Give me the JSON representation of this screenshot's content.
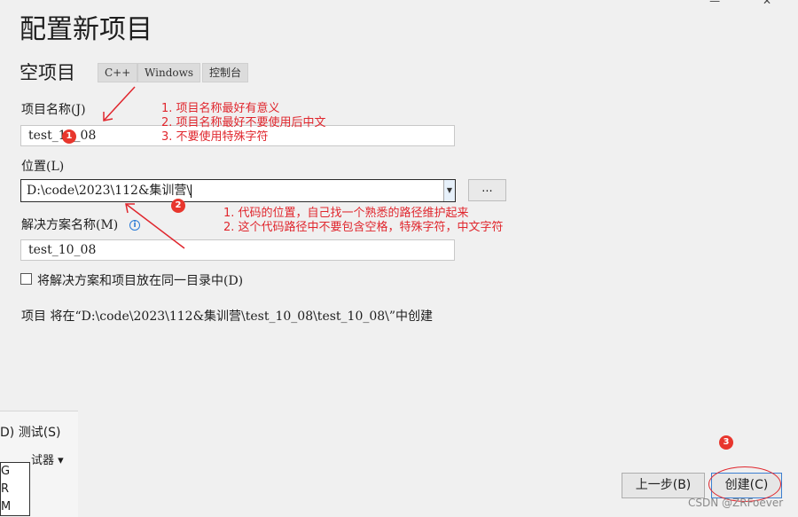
{
  "window": {
    "controls": "— ✕"
  },
  "dialog": {
    "title": "配置新项目",
    "template_name": "空项目",
    "tags": [
      "C++",
      "Windows",
      "控制台"
    ],
    "project_name_label": "项目名称(J)",
    "project_name_value": "test_10_08",
    "location_label": "位置(L)",
    "location_value": "D:\\code\\2023\\112&集训营\\",
    "browse_label": "...",
    "solution_name_label": "解决方案名称(M)",
    "solution_name_value": "test_10_08",
    "same_dir_checkbox_label": "将解决方案和项目放在同一目录中(D)",
    "summary_text": "项目 将在“D:\\code\\2023\\112&集训营\\test_10_08\\test_10_08\\”中创建",
    "back_button": "上一步(B)",
    "create_button": "创建(C)"
  },
  "annotations": {
    "badge1": "1",
    "badge2": "2",
    "badge3": "3",
    "note1_lines": [
      "1. 项目名称最好有意义",
      "2. 项目名称最好不要使用后中文",
      "3. 不要使用特殊字符"
    ],
    "note2_lines": [
      "1. 代码的位置，自己找一个熟悉的路径维护起来",
      "2. 这个代码路径中不要包含空格，特殊字符，中文字符"
    ],
    "annotation_color": "#e0262d"
  },
  "background_window": {
    "menu_text": "D)   测试(S)",
    "toolbar_text": "试器 ▾",
    "list_items": [
      "G",
      "R",
      "M"
    ]
  },
  "watermark": "CSDN @ZRFoever"
}
